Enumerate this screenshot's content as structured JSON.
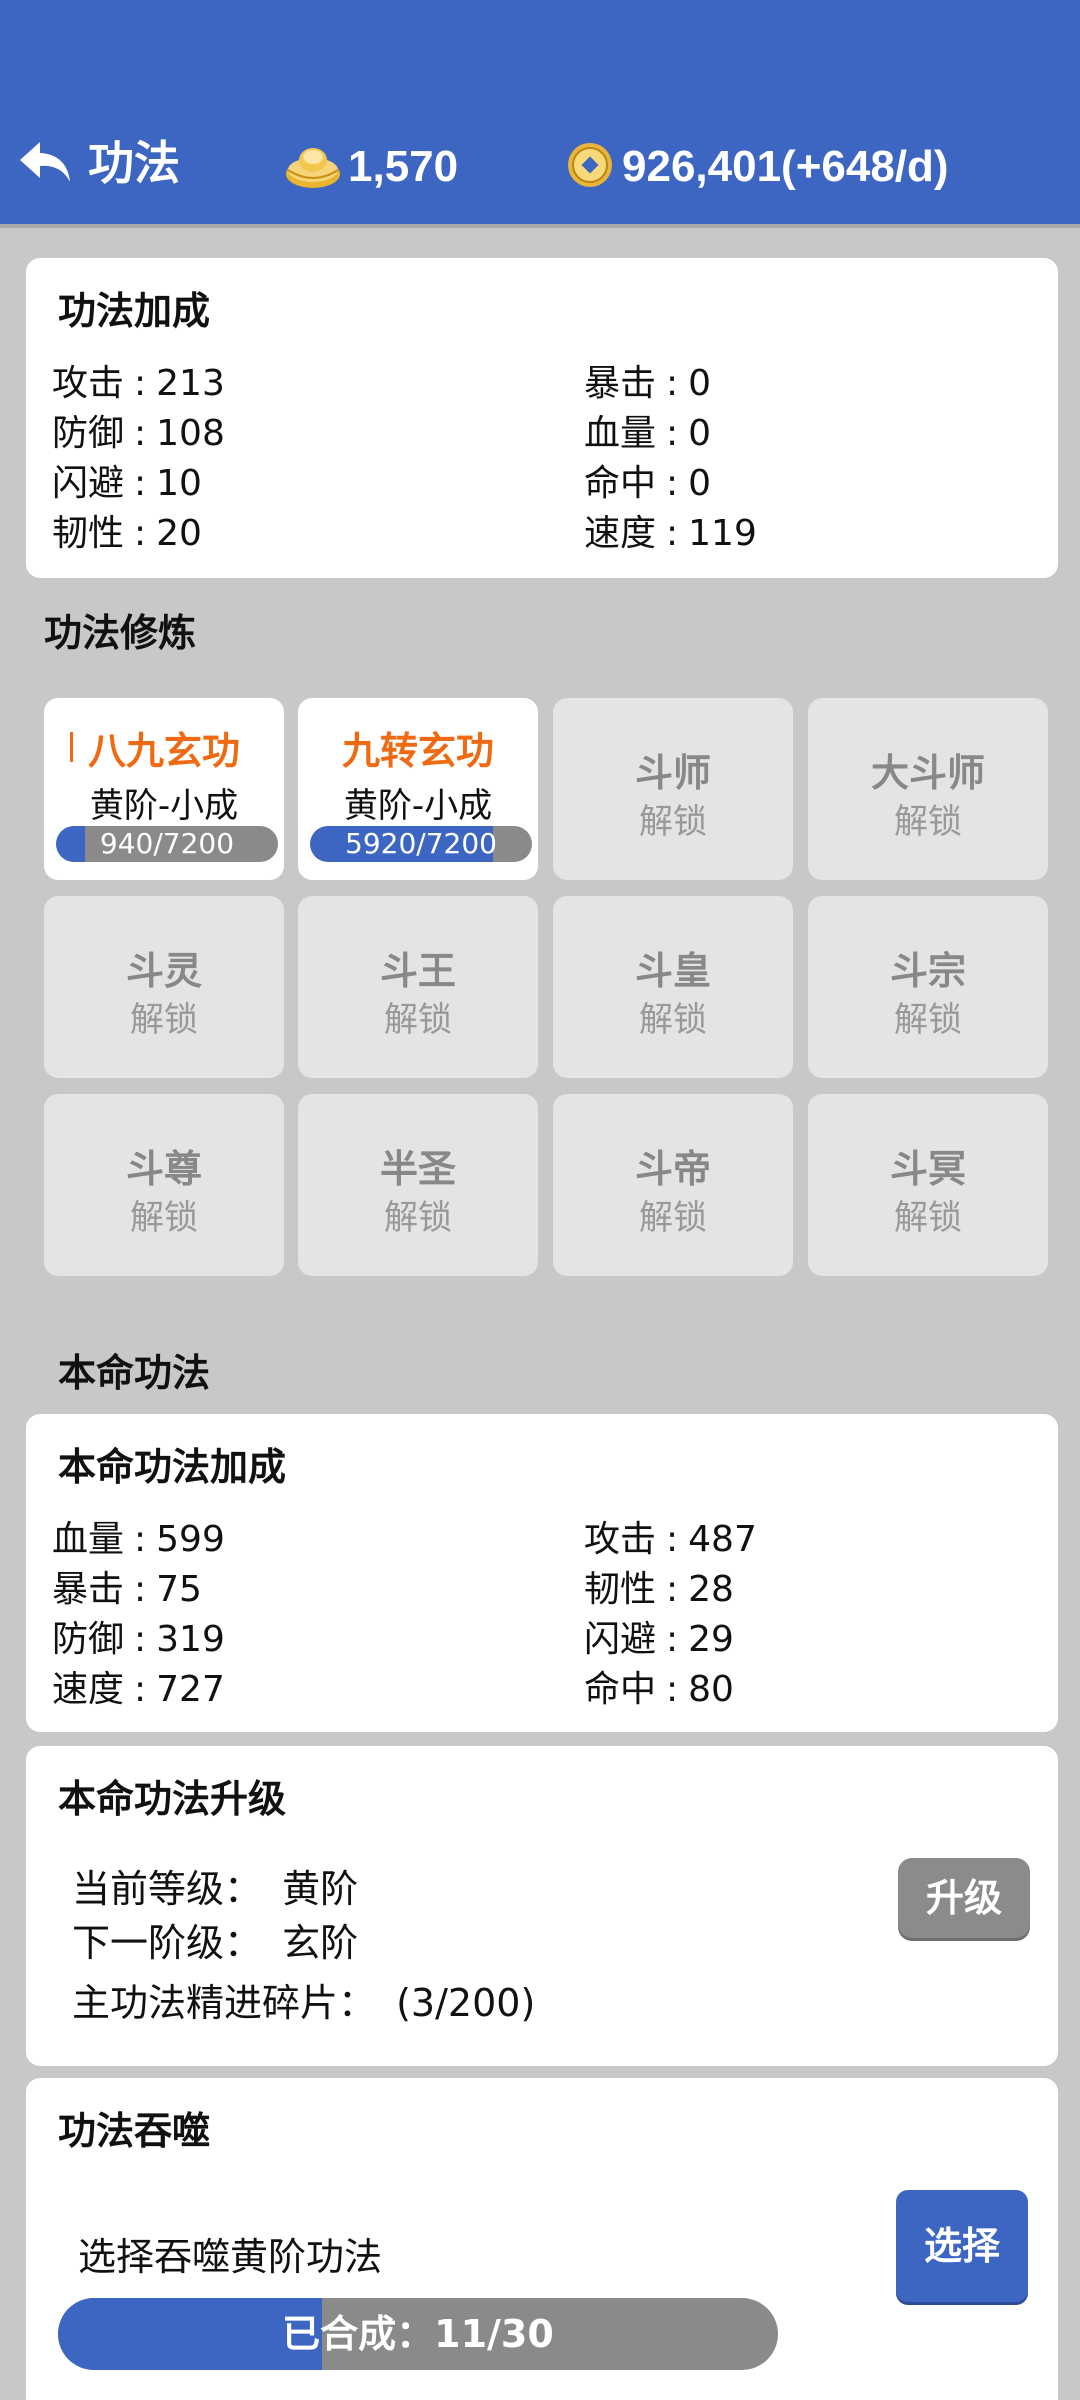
{
  "header": {
    "title": "功法",
    "gold": "1,570",
    "coins": "926,401(+648/d)",
    "back_icon": "back-arrow-icon",
    "gold_icon": "gold-ingot-icon",
    "coin_icon": "copper-coin-icon",
    "color": "#3c66c2"
  },
  "bonus": {
    "title": "功法加成",
    "sep": ":",
    "left": [
      {
        "label": "攻击",
        "value": "213"
      },
      {
        "label": "防御",
        "value": "108"
      },
      {
        "label": "闪避",
        "value": "10"
      },
      {
        "label": "韧性",
        "value": "20"
      }
    ],
    "right": [
      {
        "label": "暴击",
        "value": "0"
      },
      {
        "label": "血量",
        "value": "0"
      },
      {
        "label": "命中",
        "value": "0"
      },
      {
        "label": "速度",
        "value": "119"
      }
    ]
  },
  "cultivation": {
    "title": "功法修炼",
    "active": [
      {
        "name": "八九玄功",
        "rank": "黄阶-小成",
        "progress_text": "940/7200",
        "progress": 0.1306
      },
      {
        "name": "九转玄功",
        "rank": "黄阶-小成",
        "progress_text": "5920/7200",
        "progress": 0.8222
      }
    ],
    "locked_label": "解锁",
    "locked": [
      "斗师",
      "大斗师",
      "斗灵",
      "斗王",
      "斗皇",
      "斗宗",
      "斗尊",
      "半圣",
      "斗帝",
      "斗冥"
    ]
  },
  "natal": {
    "section_title": "本命功法",
    "bonus_title": "本命功法加成",
    "left": [
      {
        "label": "血量",
        "value": "599"
      },
      {
        "label": "暴击",
        "value": "75"
      },
      {
        "label": "防御",
        "value": "319"
      },
      {
        "label": "速度",
        "value": "727"
      }
    ],
    "right": [
      {
        "label": "攻击",
        "value": "487"
      },
      {
        "label": "韧性",
        "value": "28"
      },
      {
        "label": "闪避",
        "value": "29"
      },
      {
        "label": "命中",
        "value": "80"
      }
    ]
  },
  "upgrade": {
    "title": "本命功法升级",
    "current_label": "当前等级：",
    "current_value": "黄阶",
    "next_label": "下一阶级：",
    "next_value": "玄阶",
    "fragments_label": "主功法精进碎片：",
    "fragments_value": "(3/200)",
    "button": "升级"
  },
  "devour": {
    "title": "功法吞噬",
    "prompt": "选择吞噬黄阶功法",
    "button": "选择",
    "progress_text": "已合成：11/30",
    "progress": 0.3667
  }
}
